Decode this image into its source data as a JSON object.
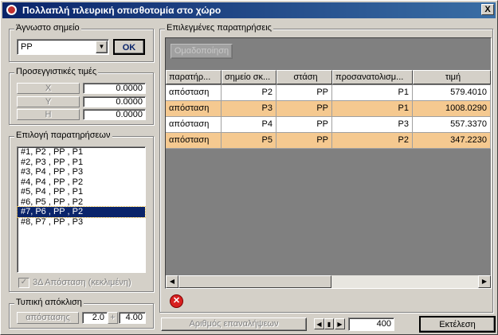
{
  "window": {
    "title": "Πολλαπλή πλευρική οπισθοτομία στο χώρο",
    "close_glyph": "X"
  },
  "known_point": {
    "label": "Άγνωστο σημείο",
    "value": "PP",
    "ok_label": "OK"
  },
  "approx": {
    "label": "Προσεγγιστικές τιμές",
    "rows": [
      {
        "name": "X",
        "value": "0.0000"
      },
      {
        "name": "Y",
        "value": "0.0000"
      },
      {
        "name": "H",
        "value": "0.0000"
      }
    ]
  },
  "obs_select": {
    "label": "Επιλογή παρατηρήσεων",
    "items": [
      "#1, P2 , PP , P1",
      "#2, P3 , PP , P1",
      "#3, P4 , PP , P3",
      "#4, P4 , PP , P2",
      "#5, P4 , PP , P1",
      "#6, P5 , PP , P2",
      "#7, P6 , PP , P2",
      "#8, P7 , PP , P3"
    ],
    "selected_index": 6,
    "checkbox_label": "3Δ Απόσταση (κεκλιμένη)"
  },
  "std_dev": {
    "label": "Τυπική απόκλιση",
    "button": "απόστασης",
    "val1": "2.0",
    "plus": "+",
    "val2": "4.00"
  },
  "selected_obs": {
    "label": "Επιλεγμένες παρατηρήσεις",
    "group_button": "Ομαδοποίηση",
    "columns": [
      "παρατήρ...",
      "σημείο σκ...",
      "στάση",
      "προσανατολισμ...",
      "τιμή"
    ],
    "rows": [
      [
        "απόσταση",
        "P2",
        "PP",
        "P1",
        "579.4010"
      ],
      [
        "απόσταση",
        "P3",
        "PP",
        "P1",
        "1008.0290"
      ],
      [
        "απόσταση",
        "P4",
        "PP",
        "P3",
        "557.3370"
      ],
      [
        "απόσταση",
        "P5",
        "PP",
        "P2",
        "347.2230"
      ]
    ],
    "row_colors": [
      "#ffffff",
      "#f5c990",
      "#ffffff",
      "#f5c990"
    ]
  },
  "bottom": {
    "iterations_label": "Αριθμός επαναλήψεων",
    "iterations_value": "400",
    "run_label": "Εκτέλεση"
  }
}
